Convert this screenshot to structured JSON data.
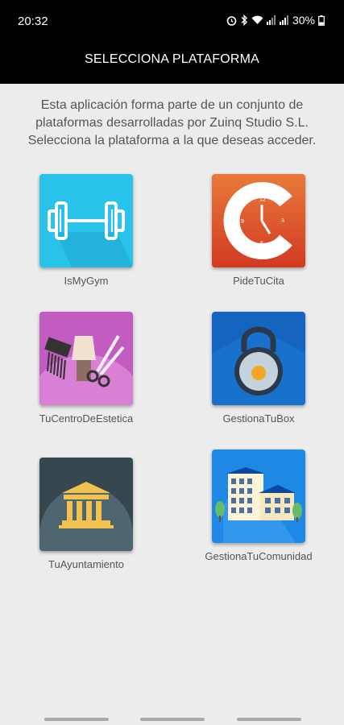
{
  "status_bar": {
    "time": "20:32",
    "battery": "30%",
    "icons": [
      "alarm-icon",
      "bluetooth-icon",
      "wifi-icon",
      "signal-icon",
      "signal-icon",
      "battery-icon"
    ]
  },
  "app_bar": {
    "title": "SELECCIONA PLATAFORMA"
  },
  "intro": {
    "text": "Esta aplicación forma parte de un conjunto de plataformas desarrolladas por Zuinq Studio S.L. Selecciona la plataforma a la que deseas acceder."
  },
  "platforms": [
    {
      "label": "IsMyGym",
      "icon": "dumbbell-icon",
      "color": "#29c2ea"
    },
    {
      "label": "PideTuCita",
      "icon": "clock-icon",
      "color": "#e0522a"
    },
    {
      "label": "TuCentroDeEstetica",
      "icon": "beauty-tools-icon",
      "color": "#c35cc0"
    },
    {
      "label": "GestionaTuBox",
      "icon": "kettlebell-icon",
      "color": "#1565c0"
    },
    {
      "label": "TuAyuntamiento",
      "icon": "townhall-icon",
      "color": "#37474f"
    },
    {
      "label": "GestionaTuComunidad",
      "icon": "building-icon",
      "color": "#1e88e5"
    }
  ]
}
